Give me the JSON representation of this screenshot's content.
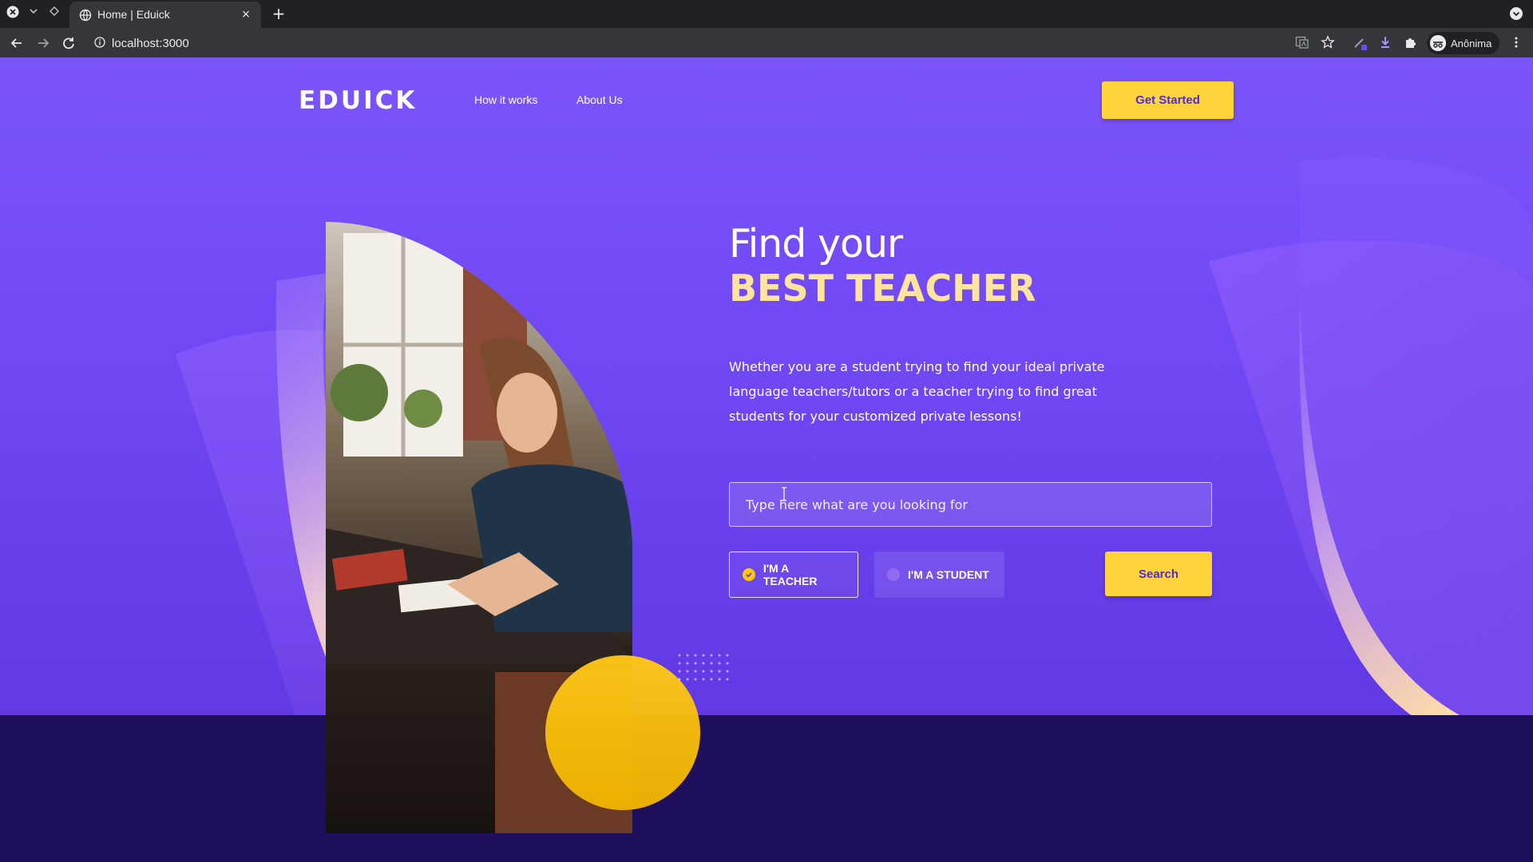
{
  "browser": {
    "tab_title": "Home | Eduick",
    "new_tab_symbol": "+",
    "tab_close_symbol": "×",
    "url": "localhost:3000",
    "profile_name": "Anônima"
  },
  "header": {
    "logo": "EDUICK",
    "nav": [
      {
        "label": "How it works"
      },
      {
        "label": "About Us"
      }
    ],
    "cta_label": "Get Started"
  },
  "hero": {
    "title_line1": "Find your",
    "title_line2": "BEST TEACHER",
    "description": "Whether you are a student trying to find your ideal private language teachers/tutors or a teacher trying to find great students for your customized private lessons!",
    "search_placeholder": "Type here what are you looking for",
    "role_teacher_label": "I'M A TEACHER",
    "role_student_label": "I'M A STUDENT",
    "selected_role": "teacher",
    "search_label": "Search"
  },
  "colors": {
    "accent_yellow": "#ffd43b",
    "brand_purple": "#6f47f3",
    "dark_navy": "#1e0f5c",
    "title_cream": "#ffe49e"
  }
}
